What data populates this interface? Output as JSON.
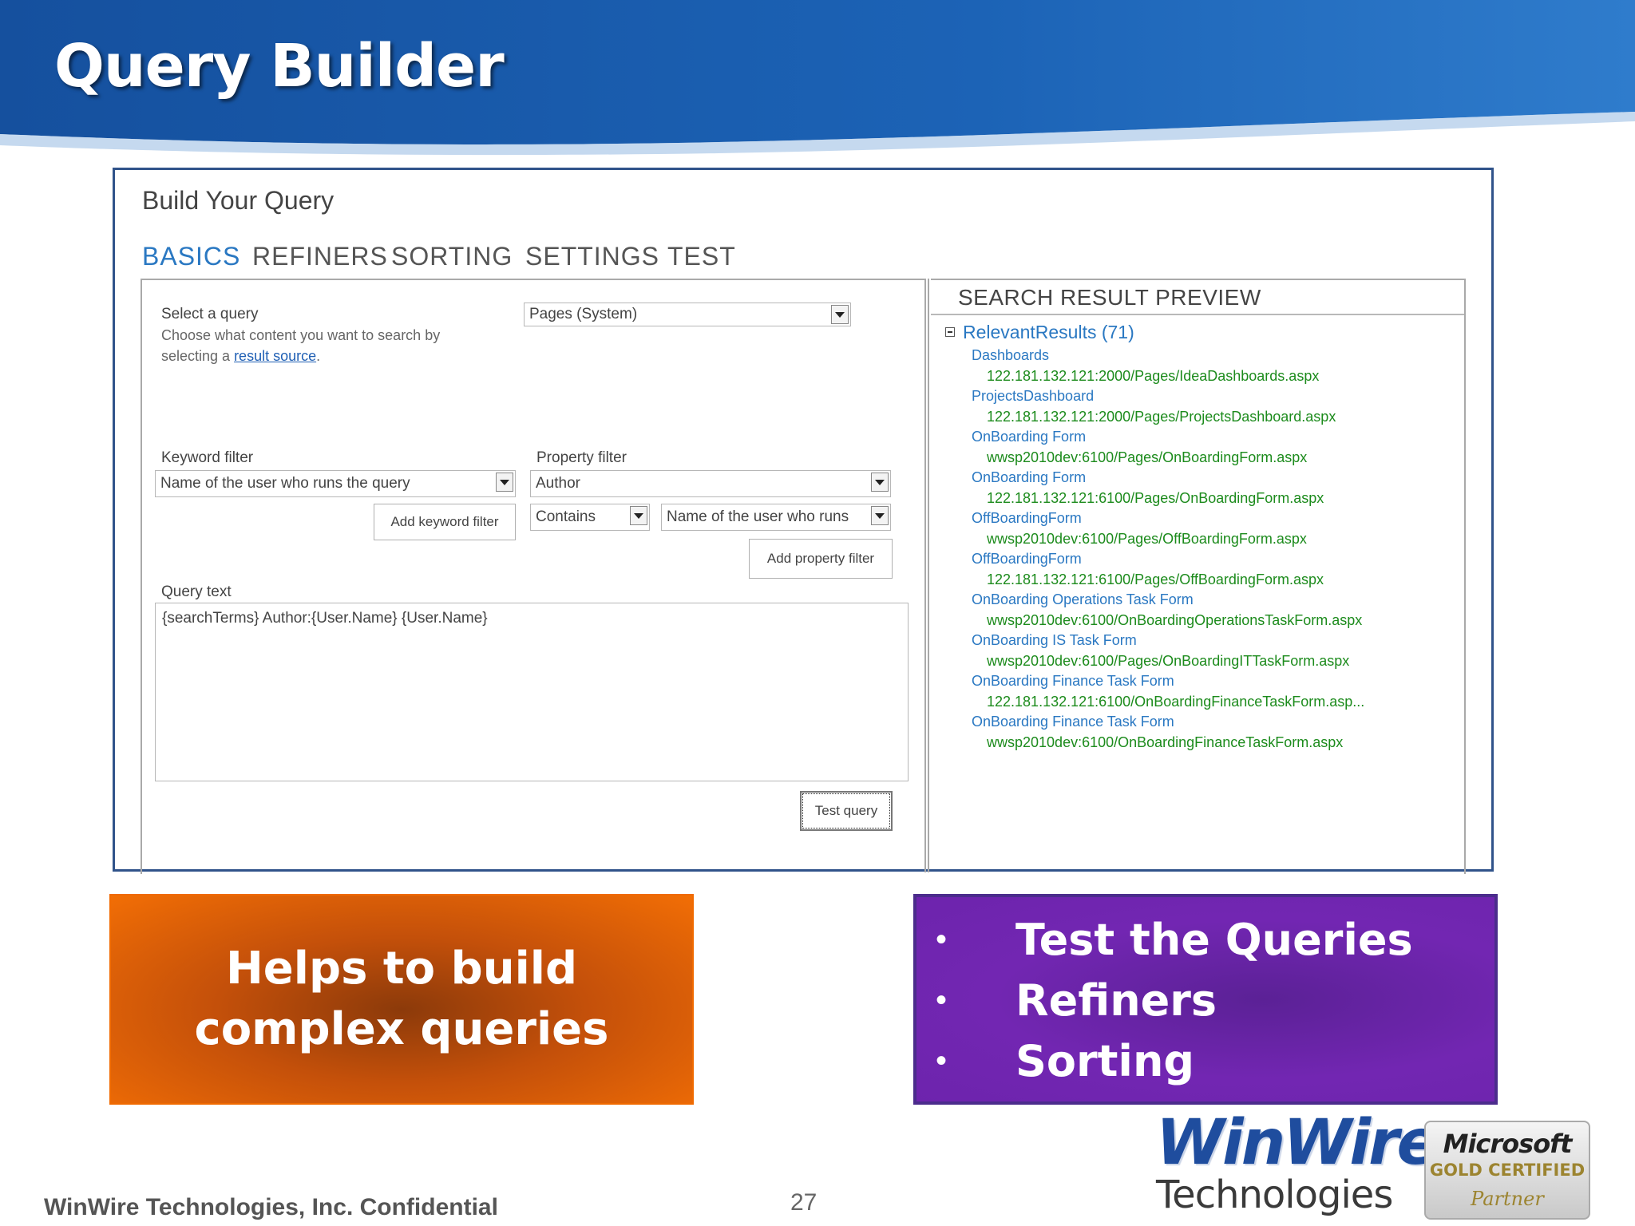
{
  "slide": {
    "title": "Query Builder",
    "footer": "WinWire Technologies, Inc. Confidential",
    "page_number": "27"
  },
  "query_builder": {
    "heading": "Build Your Query",
    "tabs": [
      {
        "label": "BASICS",
        "active": true
      },
      {
        "label": "REFINERS",
        "active": false
      },
      {
        "label": "SORTING",
        "active": false
      },
      {
        "label": "SETTINGS",
        "active": false
      },
      {
        "label": "TEST",
        "active": false
      }
    ],
    "select_query": {
      "label": "Select a query",
      "desc_line1": "Choose what content you want to search by",
      "desc_line2_prefix": "selecting a ",
      "desc_link": "result source",
      "desc_suffix": ".",
      "value": "Pages (System)"
    },
    "keyword_filter": {
      "label": "Keyword filter",
      "value": "Name of the user who runs the query",
      "button": "Add keyword filter"
    },
    "property_filter": {
      "label": "Property filter",
      "property_value": "Author",
      "operator_value": "Contains",
      "value_value": "Name of the user who runs",
      "button": "Add property filter"
    },
    "query_text": {
      "label": "Query text",
      "value": "{searchTerms} Author:{User.Name} {User.Name}"
    },
    "test_button": "Test query"
  },
  "preview": {
    "title": "SEARCH RESULT PREVIEW",
    "root": "RelevantResults (71)",
    "results": [
      {
        "title": "Dashboards",
        "url": "122.181.132.121:2000/Pages/IdeaDashboards.aspx"
      },
      {
        "title": "ProjectsDashboard",
        "url": "122.181.132.121:2000/Pages/ProjectsDashboard.aspx"
      },
      {
        "title": "OnBoarding Form",
        "url": "wwsp2010dev:6100/Pages/OnBoardingForm.aspx"
      },
      {
        "title": "OnBoarding Form",
        "url": "122.181.132.121:6100/Pages/OnBoardingForm.aspx"
      },
      {
        "title": "OffBoardingForm",
        "url": "wwsp2010dev:6100/Pages/OffBoardingForm.aspx"
      },
      {
        "title": "OffBoardingForm",
        "url": "122.181.132.121:6100/Pages/OffBoardingForm.aspx"
      },
      {
        "title": "OnBoarding Operations Task Form",
        "url": "wwsp2010dev:6100/OnBoardingOperationsTaskForm.aspx"
      },
      {
        "title": "OnBoarding IS Task Form",
        "url": "wwsp2010dev:6100/Pages/OnBoardingITTaskForm.aspx"
      },
      {
        "title": "OnBoarding Finance Task Form",
        "url": "122.181.132.121:6100/OnBoardingFinanceTaskForm.asp..."
      },
      {
        "title": "OnBoarding Finance Task Form",
        "url": "wwsp2010dev:6100/OnBoardingFinanceTaskForm.aspx"
      }
    ]
  },
  "callouts": {
    "orange_text": "Helps to build complex queries",
    "bullets": [
      "Test the Queries",
      "Refiners",
      "Sorting"
    ],
    "bullet_symbol": "•"
  },
  "logos": {
    "winwire_top": "WinWire",
    "winwire_bottom": "Technologies",
    "ms_line1": "Microsoft",
    "ms_line2": "GOLD CERTIFIED",
    "ms_line3": "Partner"
  },
  "colors": {
    "banner_blue": "#1a5cae",
    "tab_active": "#2a78c2",
    "result_title": "#2a78c2",
    "result_url": "#1c8b1c",
    "orange": "#f26e05",
    "purple": "#7226b2"
  }
}
